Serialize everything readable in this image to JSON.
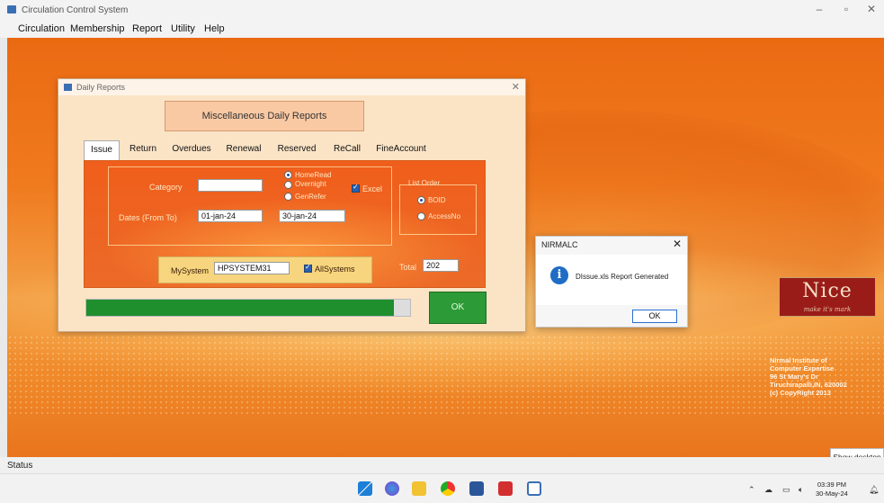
{
  "window": {
    "title": "Circulation Control System"
  },
  "menu": [
    "Circulation",
    "Membership",
    "Report",
    "Utility",
    "Help"
  ],
  "dialog": {
    "title": "Daily Reports",
    "heading": "Miscellaneous Daily Reports",
    "tabs": [
      "Issue",
      "Return",
      "Overdues",
      "Renewal",
      "Reserved",
      "ReCall",
      "FineAccount"
    ],
    "active_tab": "Issue",
    "category_label": "Category",
    "category_value": "",
    "dates_label": "Dates (From To)",
    "date_from": "01-jan-24",
    "date_to": "30-jan-24",
    "type_options": [
      "HomeRead",
      "Overnight",
      "GenRefer"
    ],
    "type_selected": "HomeRead",
    "excel_label": "Excel",
    "excel_checked": true,
    "list_order_label": "List Order",
    "list_order_options": [
      "BOID",
      "AccessNo"
    ],
    "list_order_selected": "BOID",
    "mysystem_label": "MySystem",
    "mysystem_value": "HPSYSTEM31",
    "allsystems_label": "AllSystems",
    "allsystems_checked": true,
    "total_label": "Total",
    "total_value": "202",
    "progress_percent": 95,
    "ok_label": "OK"
  },
  "message_box": {
    "title": "NIRMALC",
    "text": "DIssue.xls Report Generated",
    "ok_label": "OK"
  },
  "logo": {
    "name": "Nice",
    "tagline": "make it's mark"
  },
  "credits": [
    "Nirmal Institute of",
    "Computer Expertise",
    "96 St Mary's Dr",
    "Tiruchirapalli,IN, 620002",
    "(c) CopyRight 2013"
  ],
  "status": "Status",
  "show_desktop": "Show desktop",
  "clock": {
    "time": "03:39 PM",
    "date": "30-May-24"
  },
  "colors": {
    "accent_orange": "#f07a1e",
    "ok_green": "#2c9a37",
    "info_blue": "#1f6cc5"
  }
}
